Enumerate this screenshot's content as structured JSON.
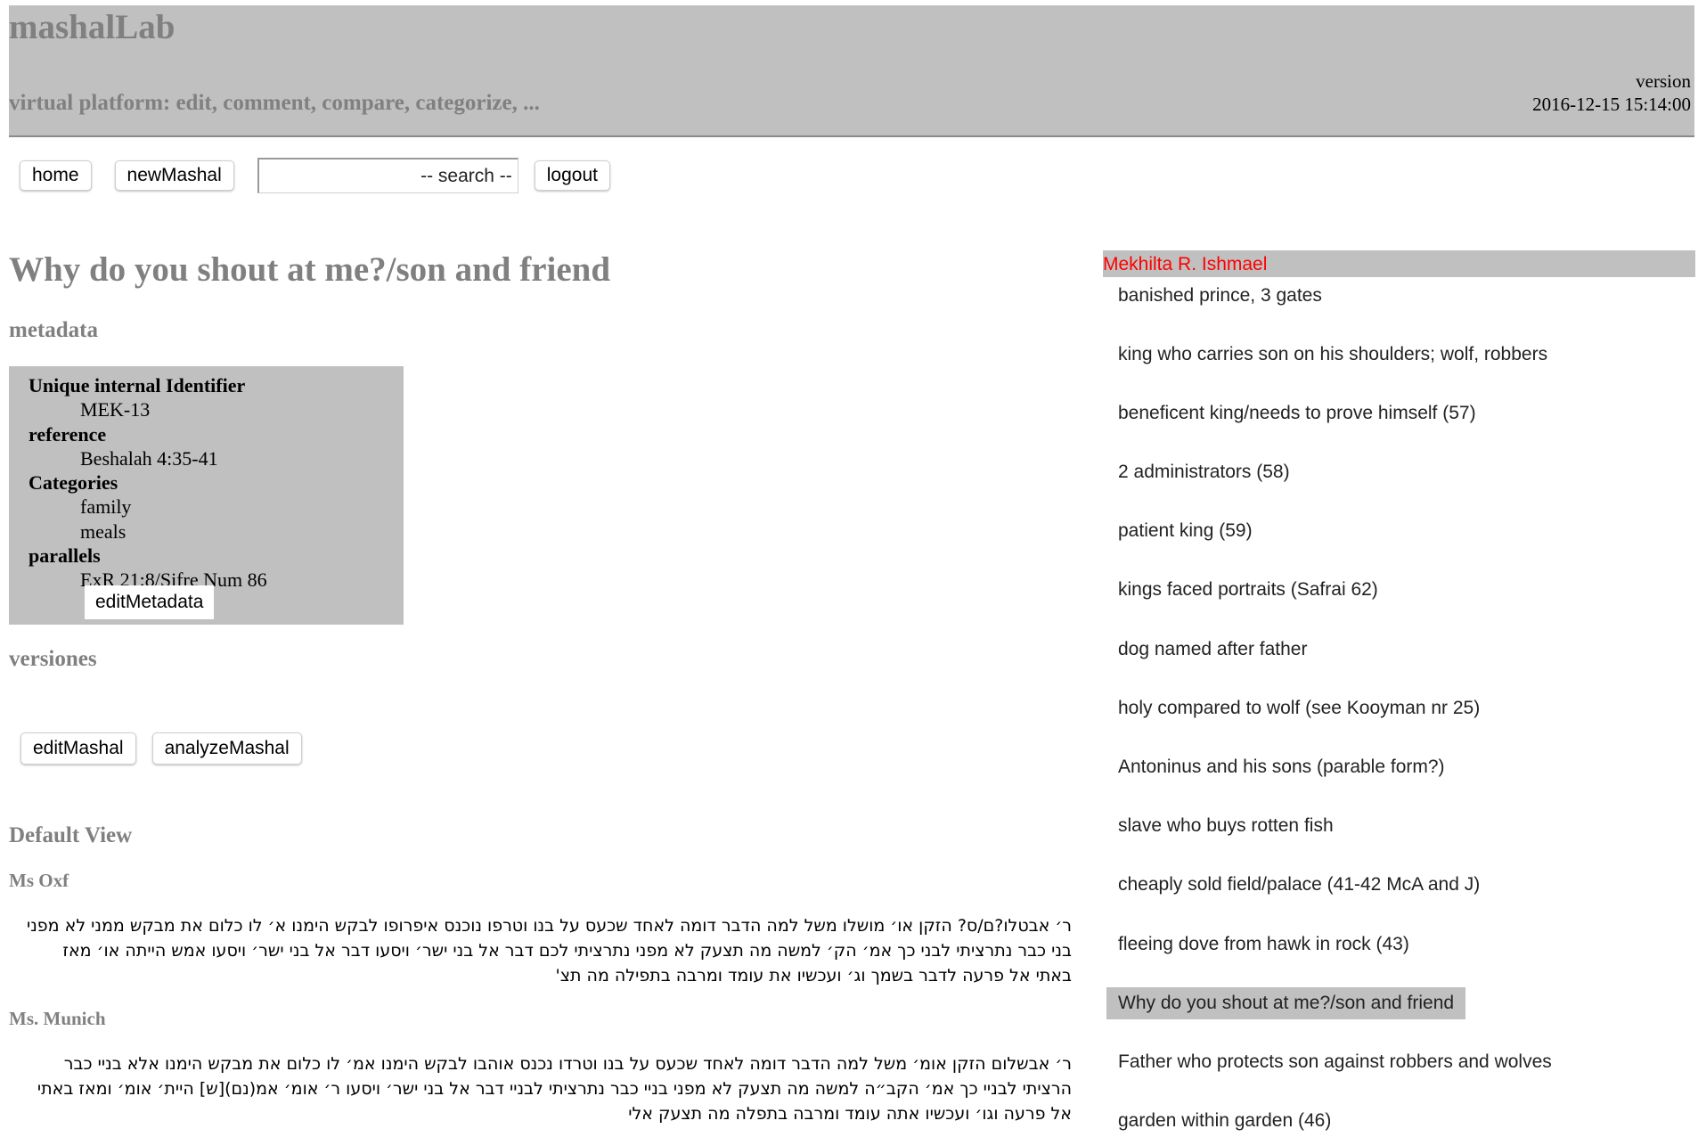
{
  "header": {
    "title": "mashalLab",
    "subtitle": "virtual platform: edit, comment, compare, categorize, ...",
    "version_label": "version",
    "version_date": "2016-12-15 15:14:00"
  },
  "nav": {
    "home": "home",
    "new_mashal": "newMashal",
    "search_placeholder": "-- search --",
    "search_value": "",
    "logout": "logout"
  },
  "mashal": {
    "title": "Why do you shout at me?/son and friend",
    "metadata_heading": "metadata",
    "metadata": {
      "id_label": "Unique internal Identifier",
      "id_value": "MEK-13",
      "reference_label": "reference",
      "reference_value": "Beshalah 4:35-41",
      "categories_label": "Categories",
      "categories": [
        "family",
        "meals"
      ],
      "parallels_label": "parallels",
      "parallels_value": "ExR 21:8/Sifre Num 86",
      "edit_button": "editMetadata"
    },
    "versiones_heading": "versiones",
    "edit_mashal": "editMashal",
    "analyze_mashal": "analyzeMashal",
    "default_view_heading": "Default View",
    "manuscripts": [
      {
        "label": "Ms Oxf",
        "text": "ר׳ אבטלו?ם/ס? הזקן או׳ מושלו משל למה הדבר דומה לאחד שכעס על בנו וטרפו נוכנס איפרופו לבקש הימנו א׳ לו כלום את מבקש ממני לא מפני בני כבר נתרציתי לבני כך אמ׳ הק׳ למשה מה תצעק לא מפני נתרציתי לכם דבר אל בני ישר׳ ויסעו דבר אל בני ישר׳ ויסעו אמש הייתה או׳ מאז באתי אל פרעה לדבר בשמך וג׳ ועכשיו את עומד ומרבה בתפילה מה תצ'"
      },
      {
        "label": "Ms. Munich",
        "text": "ר׳ אבשלום הזקן אומ׳ משל למה הדבר דומה לאחד שכעס על בנו וטרדו נכנס אוהבו לבקש הימנו אמ׳ לו כלום את מבקש הימנו אלא בניי כבר הרציתי לבניי כך אמ׳ הקב״ה למשה מה תצעק לא מפני בניי כבר נתרציתי לבניי דבר אל בני ישר׳ ויסעו ר׳ אומ׳ אמ(נם)[ש] היית׳ אומ׳ ומאז באתי אל פרעה וגו׳ ועכשיו אתה עומד ומרבה בתפלה מה תצעק אלי"
      }
    ]
  },
  "sidebar": {
    "collection": "Mekhilta R. Ishmael",
    "items": [
      {
        "label": "banished prince, 3 gates",
        "active": false
      },
      {
        "label": "king who carries son on his shoulders; wolf, robbers",
        "active": false
      },
      {
        "label": "beneficent king/needs to prove himself (57)",
        "active": false
      },
      {
        "label": "2 administrators (58)",
        "active": false
      },
      {
        "label": "patient king (59)",
        "active": false
      },
      {
        "label": "kings faced portraits (Safrai 62)",
        "active": false
      },
      {
        "label": "dog named after father",
        "active": false
      },
      {
        "label": "holy compared to wolf (see Kooyman nr 25)",
        "active": false
      },
      {
        "label": "Antoninus and his sons (parable form?)",
        "active": false
      },
      {
        "label": "slave who buys rotten fish",
        "active": false
      },
      {
        "label": "cheaply sold field/palace (41-42 McA and J)",
        "active": false
      },
      {
        "label": "fleeing dove from hawk in rock (43)",
        "active": false
      },
      {
        "label": "Why do you shout at me?/son and friend",
        "active": true
      },
      {
        "label": "Father who protects son against robbers and wolves",
        "active": false
      },
      {
        "label": "garden within garden (46)",
        "active": false
      }
    ]
  },
  "colors": {
    "panel_gray": "#c0c0c0",
    "heading_gray": "#808080",
    "collection_red": "#ff0000"
  }
}
